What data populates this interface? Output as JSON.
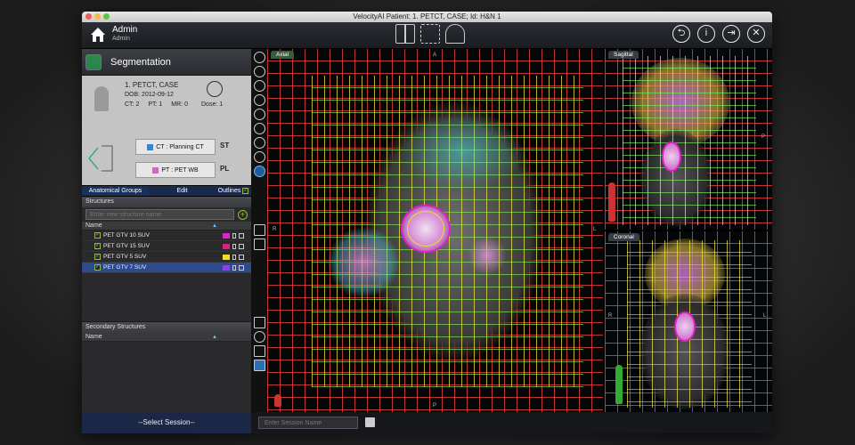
{
  "window": {
    "title": "VelocityAI Patient: 1. PETCT, CASE; Id: H&N 1"
  },
  "toolbar": {
    "user_name": "Admin",
    "user_role": "Admin",
    "right_icons": [
      "back-icon",
      "info-icon",
      "export-icon",
      "close-icon"
    ]
  },
  "segmentation": {
    "title": "Segmentation"
  },
  "patient": {
    "name": "1. PETCT, CASE",
    "dob": "DOB: 2012-09-12",
    "ct": "CT: 2",
    "pt": "PT: 1",
    "mr": "MR: 0",
    "dose": "Dose: 1"
  },
  "series": {
    "primary": "CT : Planning CT",
    "secondary": "PT : PET WB",
    "primary_tag": "ST",
    "secondary_tag": "PL"
  },
  "tabs": {
    "anatomical": "Anatomical Groups",
    "edit": "Edit",
    "outlines": "Outlines"
  },
  "structures": {
    "label": "Structures",
    "placeholder": "Enter new structure name",
    "col_name": "Name",
    "rows": [
      {
        "name": "PET GTV 10 SUV",
        "color": "#e020c8"
      },
      {
        "name": "PET GTV 15 SUV",
        "color": "#e02080"
      },
      {
        "name": "PET GTV 5 SUV",
        "color": "#f0e020"
      },
      {
        "name": "PET GTV 7 SUV",
        "color": "#9040e0"
      }
    ]
  },
  "secondary_structures": {
    "label": "Secondary Structures",
    "col_name": "Name"
  },
  "session": {
    "select": "--Select Session--",
    "name_placeholder": "Enter Session Name"
  },
  "views": {
    "axial": {
      "label": "Axial",
      "top": "A",
      "left": "R",
      "right": "L",
      "bottom": "P"
    },
    "sagittal": {
      "label": "Sagittal",
      "right": "P"
    },
    "coronal": {
      "label": "Coronal",
      "left": "R",
      "right": "L"
    }
  },
  "colors": {
    "grid_red": "#ff4646",
    "grid_yellow": "#f0e63c",
    "selection_blue": "#2e4a8e",
    "accent_green": "#8fbf3f"
  }
}
